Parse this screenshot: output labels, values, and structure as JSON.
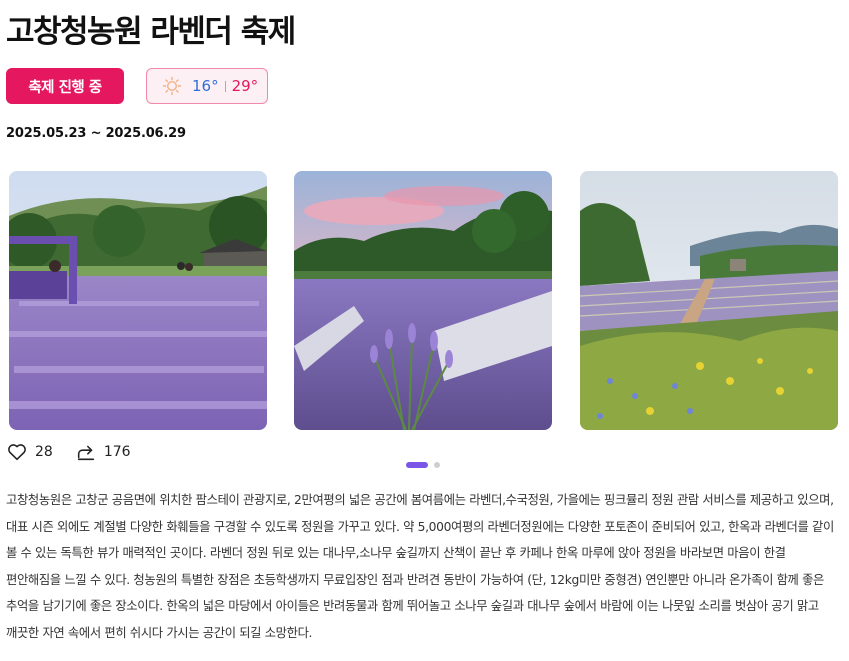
{
  "header": {
    "title": "고창청농원 라벤더 축제"
  },
  "status": {
    "label": "축제 진행 중",
    "color": "#e5175f"
  },
  "weather": {
    "icon": "sun-icon",
    "low": "16°",
    "high": "29°"
  },
  "period": {
    "dates": "2025.05.23 ~ 2025.06.29"
  },
  "gallery": {
    "photos": [
      {
        "name": "lavender-field-with-trees"
      },
      {
        "name": "lavender-field-at-sunset"
      },
      {
        "name": "lavender-rows-and-wildflowers"
      }
    ],
    "dots": {
      "total": 2,
      "active": 1
    }
  },
  "actions": {
    "like_icon": "heart-icon",
    "likes": "28",
    "share_icon": "share-icon",
    "shares": "176"
  },
  "description": "고창청농원은 고창군 공음면에 위치한 팜스테이 관광지로, 2만여평의 넓은 공간에 봄여름에는 라벤더,수국정원, 가을에는 핑크뮬리 정원 관람 서비스를 제공하고 있으며, 대표 시즌 외에도 계절별 다양한 화훼들을 구경할 수 있도록 정원을 가꾸고 있다. 약 5,000여평의 라벤더정원에는 다양한 포토존이 준비되어 있고, 한옥과 라벤더를 같이 볼 수 있는 독특한 뷰가 매력적인 곳이다. 라벤더 정원 뒤로 있는 대나무,소나무 숲길까지 산책이 끝난 후 카페나 한옥 마루에 앉아 정원을 바라보면 마음이 한결 편안해짐을 느낄 수 있다. 청농원의 특별한 장점은 초등학생까지 무료입장인 점과 반려견 동반이 가능하여 (단, 12kg미만 중형견) 연인뿐만 아니라 온가족이 함께 좋은 추억을 남기기에 좋은 장소이다. 한옥의 넓은 마당에서 아이들은 반려동물과 함께 뛰어놀고 소나무 숲길과 대나무 숲에서 바람에 이는 나뭇잎 소리를 벗삼아 공기 맑고 깨끗한 자연 속에서 편히 쉬시다 가시는 공간이 되길 소망한다."
}
